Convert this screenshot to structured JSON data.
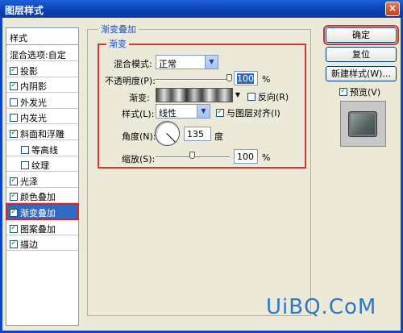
{
  "window": {
    "title": "图层样式",
    "close_glyph": "×"
  },
  "style_list": {
    "header": "样式",
    "items": [
      {
        "label": "混合选项:自定",
        "checkbox": false,
        "checked": false,
        "sub": false,
        "selected": false
      },
      {
        "label": "投影",
        "checkbox": true,
        "checked": true,
        "sub": false,
        "selected": false
      },
      {
        "label": "内阴影",
        "checkbox": true,
        "checked": true,
        "sub": false,
        "selected": false
      },
      {
        "label": "外发光",
        "checkbox": true,
        "checked": false,
        "sub": false,
        "selected": false
      },
      {
        "label": "内发光",
        "checkbox": true,
        "checked": false,
        "sub": false,
        "selected": false
      },
      {
        "label": "斜面和浮雕",
        "checkbox": true,
        "checked": true,
        "sub": false,
        "selected": false
      },
      {
        "label": "等高线",
        "checkbox": true,
        "checked": false,
        "sub": true,
        "selected": false
      },
      {
        "label": "纹理",
        "checkbox": true,
        "checked": false,
        "sub": true,
        "selected": false
      },
      {
        "label": "光泽",
        "checkbox": true,
        "checked": true,
        "sub": false,
        "selected": false
      },
      {
        "label": "颜色叠加",
        "checkbox": true,
        "checked": true,
        "sub": false,
        "selected": false
      },
      {
        "label": "渐变叠加",
        "checkbox": true,
        "checked": true,
        "sub": false,
        "selected": true
      },
      {
        "label": "图案叠加",
        "checkbox": true,
        "checked": true,
        "sub": false,
        "selected": false
      },
      {
        "label": "描边",
        "checkbox": true,
        "checked": true,
        "sub": false,
        "selected": false
      }
    ]
  },
  "panel": {
    "group_title": "渐变叠加",
    "inner_title": "渐变",
    "blend_mode_label": "混合模式:",
    "blend_mode_value": "正常",
    "opacity_label": "不透明度(P):",
    "opacity_value": "100",
    "opacity_level_percent": 100,
    "percent_unit": "%",
    "gradient_label": "渐变:",
    "reverse_label": "反向(R)",
    "reverse_checked": false,
    "style_label": "样式(L):",
    "style_value": "线性",
    "align_label": "与图层对齐(I)",
    "align_checked": true,
    "angle_label": "角度(N):",
    "angle_value": "135",
    "angle_unit": "度",
    "scale_label": "缩放(S):",
    "scale_value": "100",
    "scale_level_percent": 50
  },
  "buttons": {
    "ok": "确定",
    "reset": "复位",
    "new_style": "新建样式(W)...",
    "preview_label": "预览(V)",
    "preview_checked": true
  },
  "watermark": "UiBQ.CoM"
}
